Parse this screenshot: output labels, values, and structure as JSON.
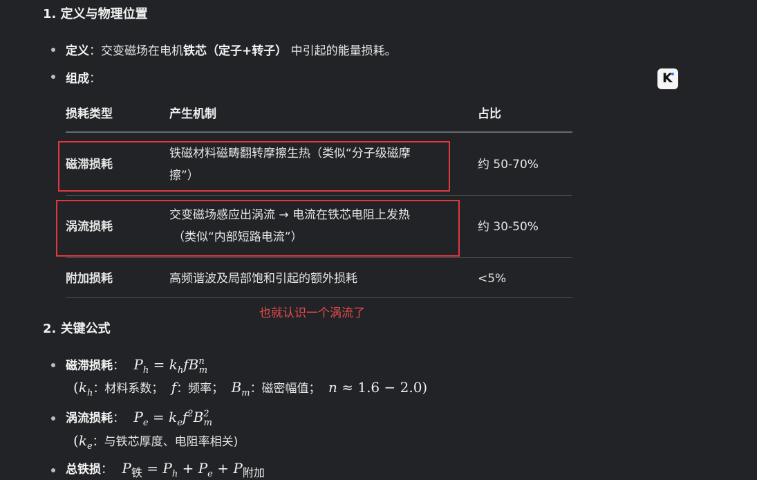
{
  "section1": {
    "heading": "1. 定义与物理位置",
    "def_label": "定义",
    "def_text_a": "：交变磁场在电机",
    "def_bold": "铁芯（定子+转子）",
    "def_text_b": " 中引起的能量损耗。",
    "comp_label": "组成",
    "comp_colon": "："
  },
  "table": {
    "headers": [
      "损耗类型",
      "产生机制",
      "占比"
    ],
    "rows": [
      {
        "type": "磁滞损耗",
        "mech_l1": "铁磁材料磁畴翻转摩擦生热（类似“分子级磁摩",
        "mech_l2": "擦”）",
        "share": "约 50-70%"
      },
      {
        "type": "涡流损耗",
        "mech_l1": "交变磁场感应出涡流 → 电流在铁芯电阻上发热",
        "mech_l2": "（类似“内部短路电流”）",
        "share": "约 30-50%"
      },
      {
        "type": "附加损耗",
        "mech_l1": "高频谐波及局部饱和引起的额外损耗",
        "mech_l2": "",
        "share": "<5%"
      }
    ]
  },
  "annotation": "也就认识一个涡流了",
  "section2": {
    "heading": "2. 关键公式",
    "hys_label": "磁滞损耗",
    "hys_note_kh": "材料系数；",
    "hys_note_f": "频率；",
    "hys_note_bm": "磁密幅值；",
    "hys_note_n": "1.6 − 2.0)",
    "eddy_label": "涡流损耗",
    "eddy_note": "与铁芯厚度、电阻率相关)",
    "total_label": "总铁损",
    "sub_iron": "铁",
    "sub_add": "附加"
  },
  "icon": {
    "name": "k-logo-icon",
    "letter": "K"
  }
}
